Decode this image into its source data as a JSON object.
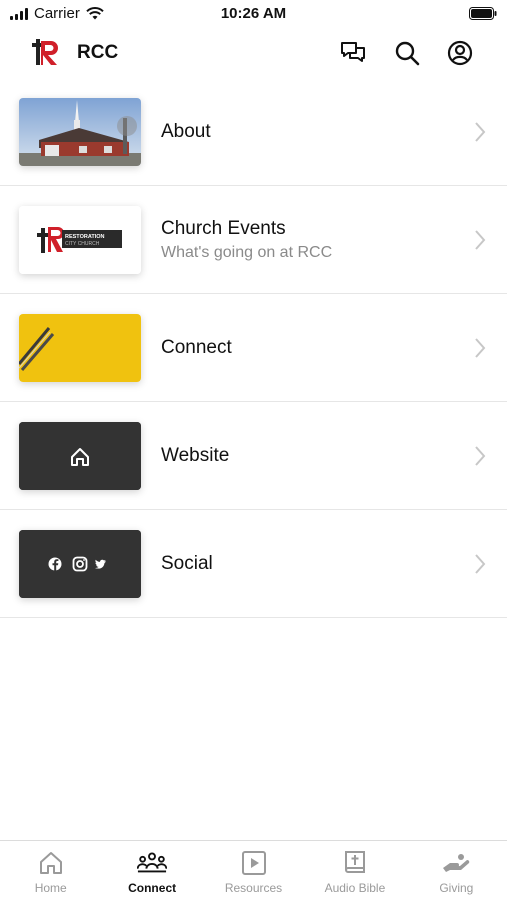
{
  "status_bar": {
    "carrier": "Carrier",
    "time": "10:26 AM"
  },
  "header": {
    "title": "RCC"
  },
  "rows": [
    {
      "title": "About",
      "subtitle": ""
    },
    {
      "title": "Church Events",
      "subtitle": "What's going on at RCC",
      "thumb_text_1": "RESTORATION",
      "thumb_text_2": "CITY CHURCH"
    },
    {
      "title": "Connect",
      "subtitle": ""
    },
    {
      "title": "Website",
      "subtitle": ""
    },
    {
      "title": "Social",
      "subtitle": ""
    }
  ],
  "tabs": [
    {
      "label": "Home",
      "icon": "home-icon"
    },
    {
      "label": "Connect",
      "icon": "people-icon",
      "active": true
    },
    {
      "label": "Resources",
      "icon": "play-icon"
    },
    {
      "label": "Audio Bible",
      "icon": "bible-icon"
    },
    {
      "label": "Giving",
      "icon": "giving-hand-icon"
    }
  ],
  "colors": {
    "accent": "#d0202a",
    "connect_thumb": "#f0c20f",
    "dark_thumb": "#333333"
  }
}
